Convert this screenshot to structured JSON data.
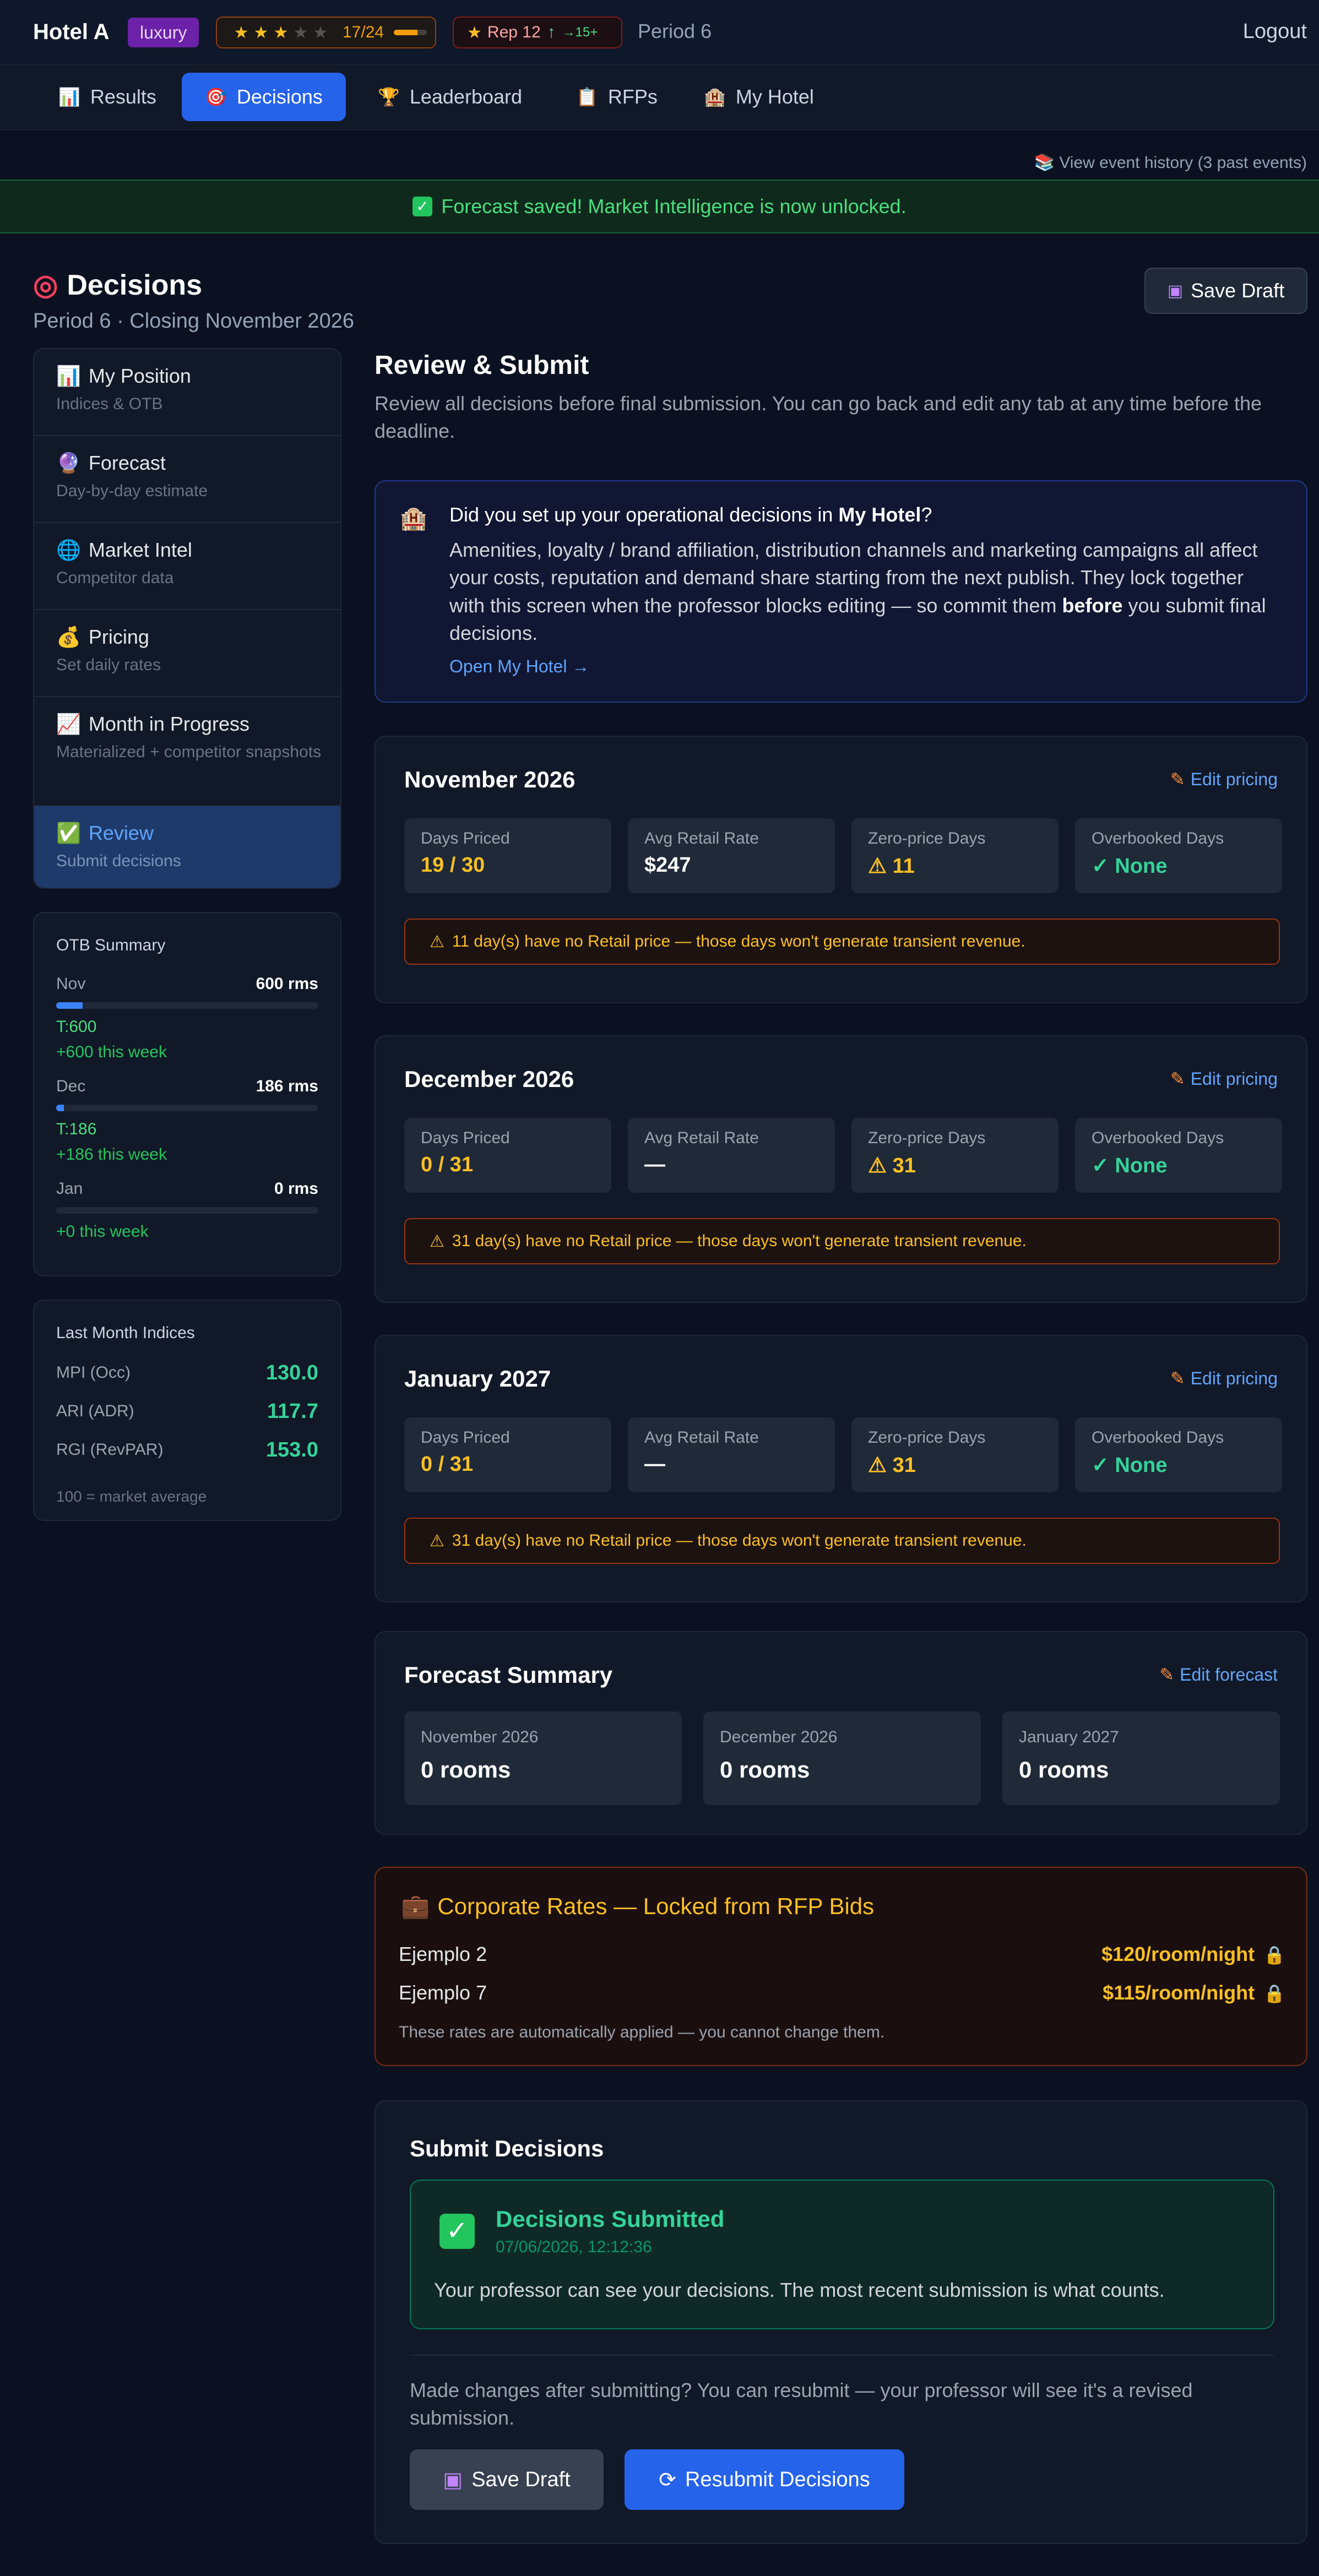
{
  "header": {
    "hotel_name": "Hotel A",
    "tier": "luxury",
    "stars": {
      "filled": 3,
      "total": 5,
      "score": "17/24",
      "progress_fraction": 0.71
    },
    "reputation": {
      "label": "Rep 12",
      "trend": "↑",
      "target": "→15+"
    },
    "period": "Period 6",
    "logout": "Logout"
  },
  "nav": {
    "tabs": [
      {
        "icon": "📊",
        "label": "Results"
      },
      {
        "icon": "🎯",
        "label": "Decisions",
        "active": true
      },
      {
        "icon": "🏆",
        "label": "Leaderboard"
      },
      {
        "icon": "📋",
        "label": "RFPs"
      },
      {
        "icon": "🏨",
        "label": "My Hotel"
      }
    ]
  },
  "event_history": "📚 View event history (3 past events)",
  "toast": {
    "icon": "✓",
    "text": "Forecast saved! Market Intelligence is now unlocked."
  },
  "page": {
    "title": "Decisions",
    "subtitle": "Period 6 · Closing November 2026",
    "save_draft": "Save Draft"
  },
  "sidebar": {
    "steps": [
      {
        "icon": "📊",
        "title": "My Position",
        "desc": "Indices & OTB"
      },
      {
        "icon": "🔮",
        "title": "Forecast",
        "desc": "Day-by-day estimate"
      },
      {
        "icon": "🌐",
        "title": "Market Intel",
        "desc": "Competitor data"
      },
      {
        "icon": "💰",
        "title": "Pricing",
        "desc": "Set daily rates"
      },
      {
        "icon": "📈",
        "title": "Month in Progress",
        "desc": "Materialized + competitor snapshots"
      },
      {
        "icon": "✅",
        "title": "Review",
        "desc": "Submit decisions",
        "active": true
      }
    ],
    "otb": {
      "title": "OTB Summary",
      "rows": [
        {
          "month": "Nov",
          "value": "600 rms",
          "target": "T:600",
          "week": "+600 this week",
          "fill": 0.1
        },
        {
          "month": "Dec",
          "value": "186 rms",
          "target": "T:186",
          "week": "+186 this week",
          "fill": 0.03
        },
        {
          "month": "Jan",
          "value": "0 rms",
          "target": "",
          "week": "+0 this week",
          "fill": 0
        }
      ]
    },
    "indices": {
      "title": "Last Month Indices",
      "rows": [
        {
          "label": "MPI (Occ)",
          "value": "130.0"
        },
        {
          "label": "ARI (ADR)",
          "value": "117.7"
        },
        {
          "label": "RGI (RevPAR)",
          "value": "153.0"
        }
      ],
      "note": "100 = market average"
    }
  },
  "main": {
    "title": "Review & Submit",
    "description": "Review all decisions before final submission. You can go back and edit any tab at any time before the deadline.",
    "notice": {
      "icon": "🏨",
      "question_pre": "Did you set up your operational decisions in ",
      "question_bold": "My Hotel",
      "question_post": "?",
      "body_pre": "Amenities, loyalty / brand affiliation, distribution channels and marketing campaigns all affect your costs, reputation and demand share starting from the next publish. They lock together with this screen when the professor blocks editing — so commit them ",
      "body_bold": "before",
      "body_post": " you submit final decisions.",
      "link": "Open My Hotel →"
    },
    "months": [
      {
        "name": "November 2026",
        "edit": "Edit pricing",
        "tiles": [
          {
            "label": "Days Priced",
            "value": "19 / 30",
            "style": "warn"
          },
          {
            "label": "Avg Retail Rate",
            "value": "$247",
            "style": ""
          },
          {
            "label": "Zero-price Days",
            "value": "⚠ 11",
            "style": "warn"
          },
          {
            "label": "Overbooked Days",
            "value": "✓ None",
            "style": "good"
          }
        ],
        "alert": "11 day(s) have no Retail price — those days won't generate transient revenue."
      },
      {
        "name": "December 2026",
        "edit": "Edit pricing",
        "tiles": [
          {
            "label": "Days Priced",
            "value": "0 / 31",
            "style": "warn"
          },
          {
            "label": "Avg Retail Rate",
            "value": "—",
            "style": ""
          },
          {
            "label": "Zero-price Days",
            "value": "⚠ 31",
            "style": "warn"
          },
          {
            "label": "Overbooked Days",
            "value": "✓ None",
            "style": "good"
          }
        ],
        "alert": "31 day(s) have no Retail price — those days won't generate transient revenue."
      },
      {
        "name": "January 2027",
        "edit": "Edit pricing",
        "tiles": [
          {
            "label": "Days Priced",
            "value": "0 / 31",
            "style": "warn"
          },
          {
            "label": "Avg Retail Rate",
            "value": "—",
            "style": ""
          },
          {
            "label": "Zero-price Days",
            "value": "⚠ 31",
            "style": "warn"
          },
          {
            "label": "Overbooked Days",
            "value": "✓ None",
            "style": "good"
          }
        ],
        "alert": "31 day(s) have no Retail price — those days won't generate transient revenue."
      }
    ],
    "forecast": {
      "title": "Forecast Summary",
      "edit": "Edit forecast",
      "tiles": [
        {
          "label": "November 2026",
          "value": "0 rooms"
        },
        {
          "label": "December 2026",
          "value": "0 rooms"
        },
        {
          "label": "January 2027",
          "value": "0 rooms"
        }
      ]
    },
    "corporate": {
      "icon": "💼",
      "title": "Corporate Rates — Locked from RFP Bids",
      "rows": [
        {
          "name": "Ejemplo 2",
          "rate": "$120/room/night"
        },
        {
          "name": "Ejemplo 7",
          "rate": "$115/room/night"
        }
      ],
      "note": "These rates are automatically applied — you cannot change them."
    },
    "submit": {
      "title": "Submit Decisions",
      "status_title": "Decisions Submitted",
      "timestamp": "07/06/2026, 12:12:36",
      "status_body": "Your professor can see your decisions. The most recent submission is what counts.",
      "resubmit_note": "Made changes after submitting? You can resubmit — your professor will see it's a revised submission.",
      "save_draft": "Save Draft",
      "resubmit": "Resubmit Decisions"
    }
  }
}
